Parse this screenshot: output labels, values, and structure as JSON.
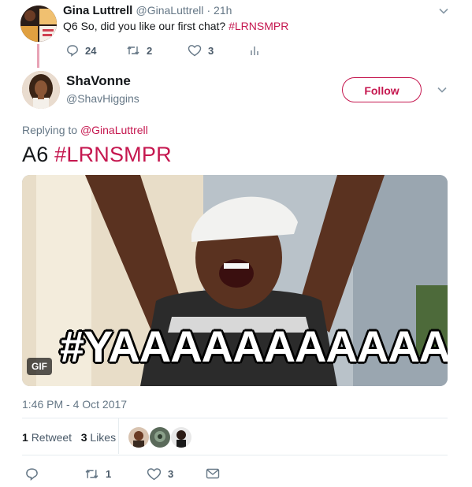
{
  "parent_tweet": {
    "name": "Gina Luttrell",
    "handle": "@GinaLuttrell",
    "time": "· 21h",
    "text_prefix": "Q6 So, did you like our first chat?",
    "hashtag": "#LRNSMPR",
    "replies": "24",
    "retweets": "2",
    "likes": "3"
  },
  "main_tweet": {
    "name": "ShaVonne",
    "handle": "@ShavHiggins",
    "follow_label": "Follow",
    "reply_prefix": "Replying to",
    "reply_handle": "@GinaLuttrell",
    "text_prefix": "A6",
    "hashtag": "#LRNSMPR",
    "media": {
      "badge": "GIF",
      "caption": "#YAAAAAAAAAAAS"
    },
    "timestamp": "1:46 PM - 4 Oct 2017",
    "retweet_count": "1",
    "retweet_label": "Retweet",
    "like_count": "3",
    "like_label": "Likes",
    "actions": {
      "retweets": "1",
      "likes": "3"
    }
  },
  "colors": {
    "accent": "#c5174f",
    "muted": "#657786"
  },
  "icons": [
    "chevron-down-icon",
    "reply-icon",
    "retweet-icon",
    "heart-icon",
    "analytics-icon",
    "message-icon"
  ]
}
